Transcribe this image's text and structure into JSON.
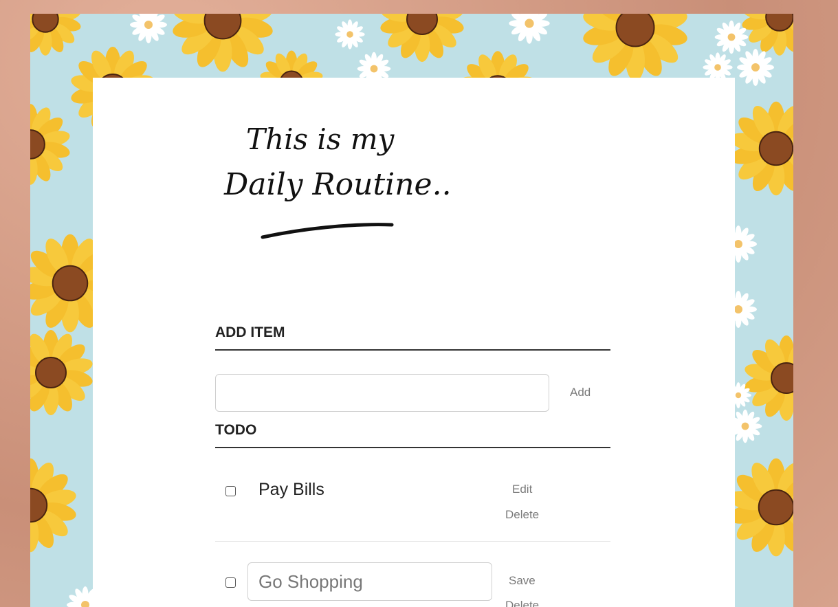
{
  "header": {
    "title_line1": "This is my",
    "title_line2": "Daily Routine..."
  },
  "add_section": {
    "heading": "ADD ITEM",
    "input_value": "",
    "add_label": "Add"
  },
  "todo_section": {
    "heading": "TODO",
    "items": [
      {
        "label": "Pay Bills",
        "checked": false,
        "edit_label": "Edit",
        "delete_label": "Delete"
      },
      {
        "label": "Go Shopping",
        "checked": false,
        "editing": true,
        "save_label": "Save",
        "delete_label": "Delete"
      }
    ]
  },
  "colors": {
    "frame_background": "#bfe0e6",
    "petal": "#f5bf2e",
    "seed": "#8b4a22",
    "outer": "#d9a590"
  },
  "icons": [
    "sunflower-icon",
    "daisy-icon",
    "checkbox-icon"
  ]
}
